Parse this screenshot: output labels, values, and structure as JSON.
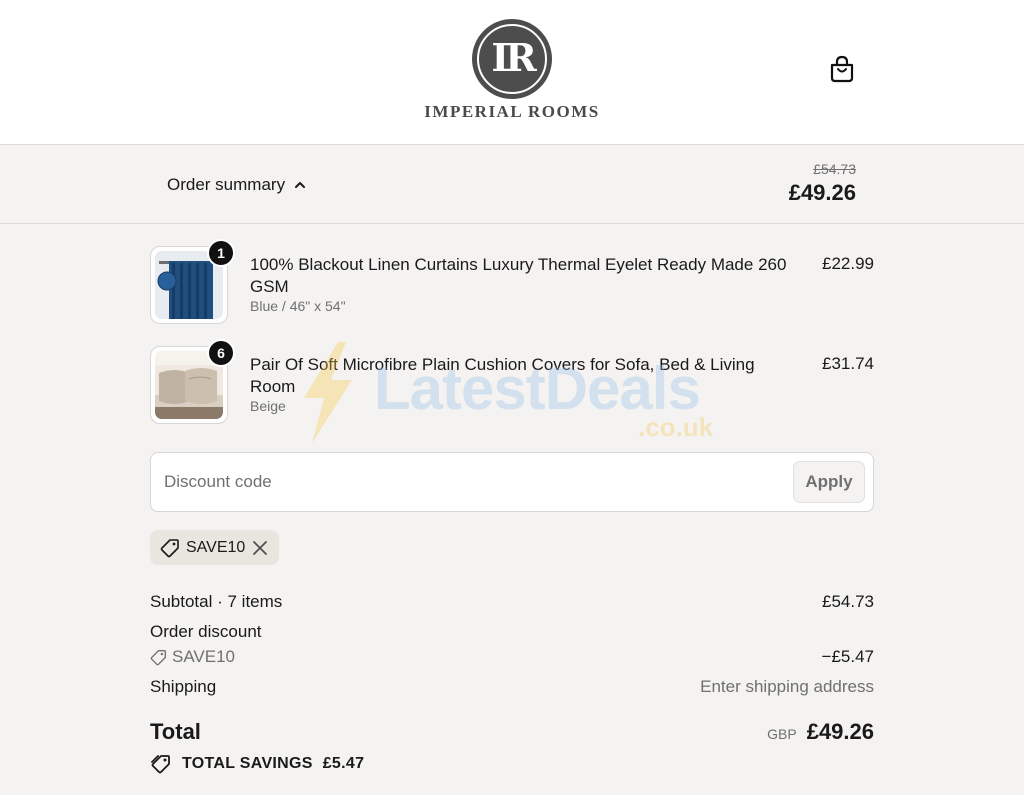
{
  "brand": {
    "monogram": "IR",
    "name": "IMPERIAL ROOMS"
  },
  "header": {
    "bag_icon": "shopping-bag-icon"
  },
  "summary": {
    "toggle_label": "Order summary",
    "toggle_icon": "chevron-up-icon",
    "original_total": "£54.73",
    "total": "£49.26"
  },
  "items": [
    {
      "quantity": "1",
      "title": "100% Blackout Linen Curtains Luxury Thermal Eyelet Ready Made 260 GSM",
      "variant": "Blue / 46\" x 54\"",
      "price": "£22.99"
    },
    {
      "quantity": "6",
      "title": "Pair Of Soft Microfibre Plain Cushion Covers for Sofa, Bed & Living Room",
      "variant": "Beige",
      "price": "£31.74"
    }
  ],
  "discount": {
    "placeholder": "Discount code",
    "apply_label": "Apply",
    "applied_code": "SAVE10"
  },
  "totals": {
    "subtotal_label": "Subtotal · 7 items",
    "subtotal_value": "£54.73",
    "order_discount_label": "Order discount",
    "order_discount_code": "SAVE10",
    "order_discount_value": "−£5.47",
    "shipping_label": "Shipping",
    "shipping_value": "Enter shipping address",
    "total_label": "Total",
    "currency": "GBP",
    "total_value": "£49.26",
    "savings_label": "TOTAL SAVINGS",
    "savings_value": "£5.47"
  },
  "watermark": {
    "text": "LatestDeals",
    "domain": ".co.uk"
  },
  "colors": {
    "background": "#f4f3f1",
    "text": "#1a1a1a",
    "muted": "#707070",
    "badge": "#111111",
    "chip": "#e9e5df"
  }
}
